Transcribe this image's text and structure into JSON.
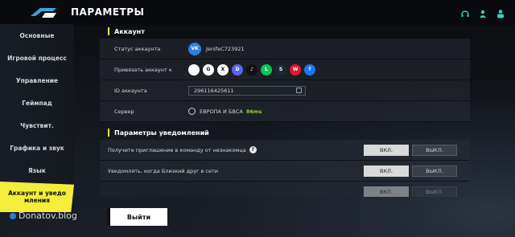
{
  "header": {
    "title": "ПАРАМЕТРЫ",
    "icons": [
      "headset-icon",
      "user-support-icon",
      "profile-icon"
    ]
  },
  "sidebar": {
    "items": [
      {
        "label": "Основные"
      },
      {
        "label": "Игровой процесс"
      },
      {
        "label": "Управление"
      },
      {
        "label": "Геймпад"
      },
      {
        "label": "Чувствит."
      },
      {
        "label": "Графика и звук"
      },
      {
        "label": "Язык"
      },
      {
        "label": "Аккаунт и уведо\nмления"
      }
    ]
  },
  "account": {
    "section_title": "Аккаунт",
    "status_label": "Статус аккаунта",
    "vk_badge": "VK",
    "username": "JenifeC723921",
    "link_label": "Привязать аккаунт к",
    "social": [
      {
        "name": "apple-icon",
        "glyph": "",
        "color": "#ffffff"
      },
      {
        "name": "google-icon",
        "glyph": "G",
        "color": "#ffffff"
      },
      {
        "name": "x-icon",
        "glyph": "X",
        "color": "#ffffff"
      },
      {
        "name": "discord-icon",
        "glyph": "D",
        "color": "#5865f2"
      },
      {
        "name": "tiktok-icon",
        "glyph": "♪",
        "color": "#111111"
      },
      {
        "name": "line-icon",
        "glyph": "L",
        "color": "#06c755"
      },
      {
        "name": "steam-icon",
        "glyph": "S",
        "color": "#1b2838"
      },
      {
        "name": "weibo-icon",
        "glyph": "W",
        "color": "#e6162d"
      },
      {
        "name": "facebook-icon",
        "glyph": "f",
        "color": "#1877f2"
      }
    ],
    "id_label": "ID аккаунта",
    "id_value": "296116425611",
    "server_label": "Сервер",
    "server_value": "ЕВРОПА И БВСА",
    "ping": "86ms"
  },
  "notifications": {
    "section_title": "Параметры уведомлений",
    "rows": [
      {
        "label": "Получите приглашение в команду от незнакомца",
        "on": "ВКЛ.",
        "off": "ВЫКЛ."
      },
      {
        "label": "Уведомлять, когда Близкий друг в сети",
        "on": "ВКЛ.",
        "off": "ВЫКЛ."
      },
      {
        "label": "",
        "on": "ВКЛ.",
        "off": "ВЫКЛ."
      }
    ]
  },
  "footer": {
    "exit_label": "Выйти",
    "watermark": "Donatov.blog"
  }
}
